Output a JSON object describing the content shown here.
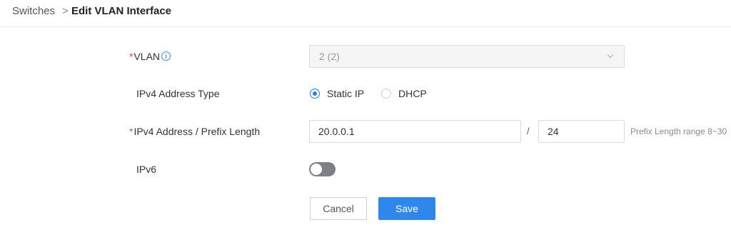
{
  "breadcrumb": {
    "parent": "Switches",
    "separator": ">",
    "current": "Edit VLAN Interface"
  },
  "form": {
    "required_mark": "*",
    "vlan": {
      "label": "VLAN",
      "value": "2 (2)",
      "icon": "info-icon"
    },
    "ipv4_type": {
      "label": "IPv4 Address Type",
      "options": [
        {
          "label": "Static IP",
          "selected": true
        },
        {
          "label": "DHCP",
          "selected": false
        }
      ]
    },
    "ipv4_address": {
      "label": "IPv4 Address / Prefix Length",
      "address": "20.0.0.1",
      "separator": "/",
      "prefix": "24",
      "hint": "Prefix Length range 8~30"
    },
    "ipv6": {
      "label": "IPv6",
      "enabled": false
    }
  },
  "actions": {
    "cancel": "Cancel",
    "save": "Save"
  },
  "colors": {
    "accent": "#2f87ec",
    "required": "#e0503c",
    "toggle_off": "#7d8187"
  }
}
